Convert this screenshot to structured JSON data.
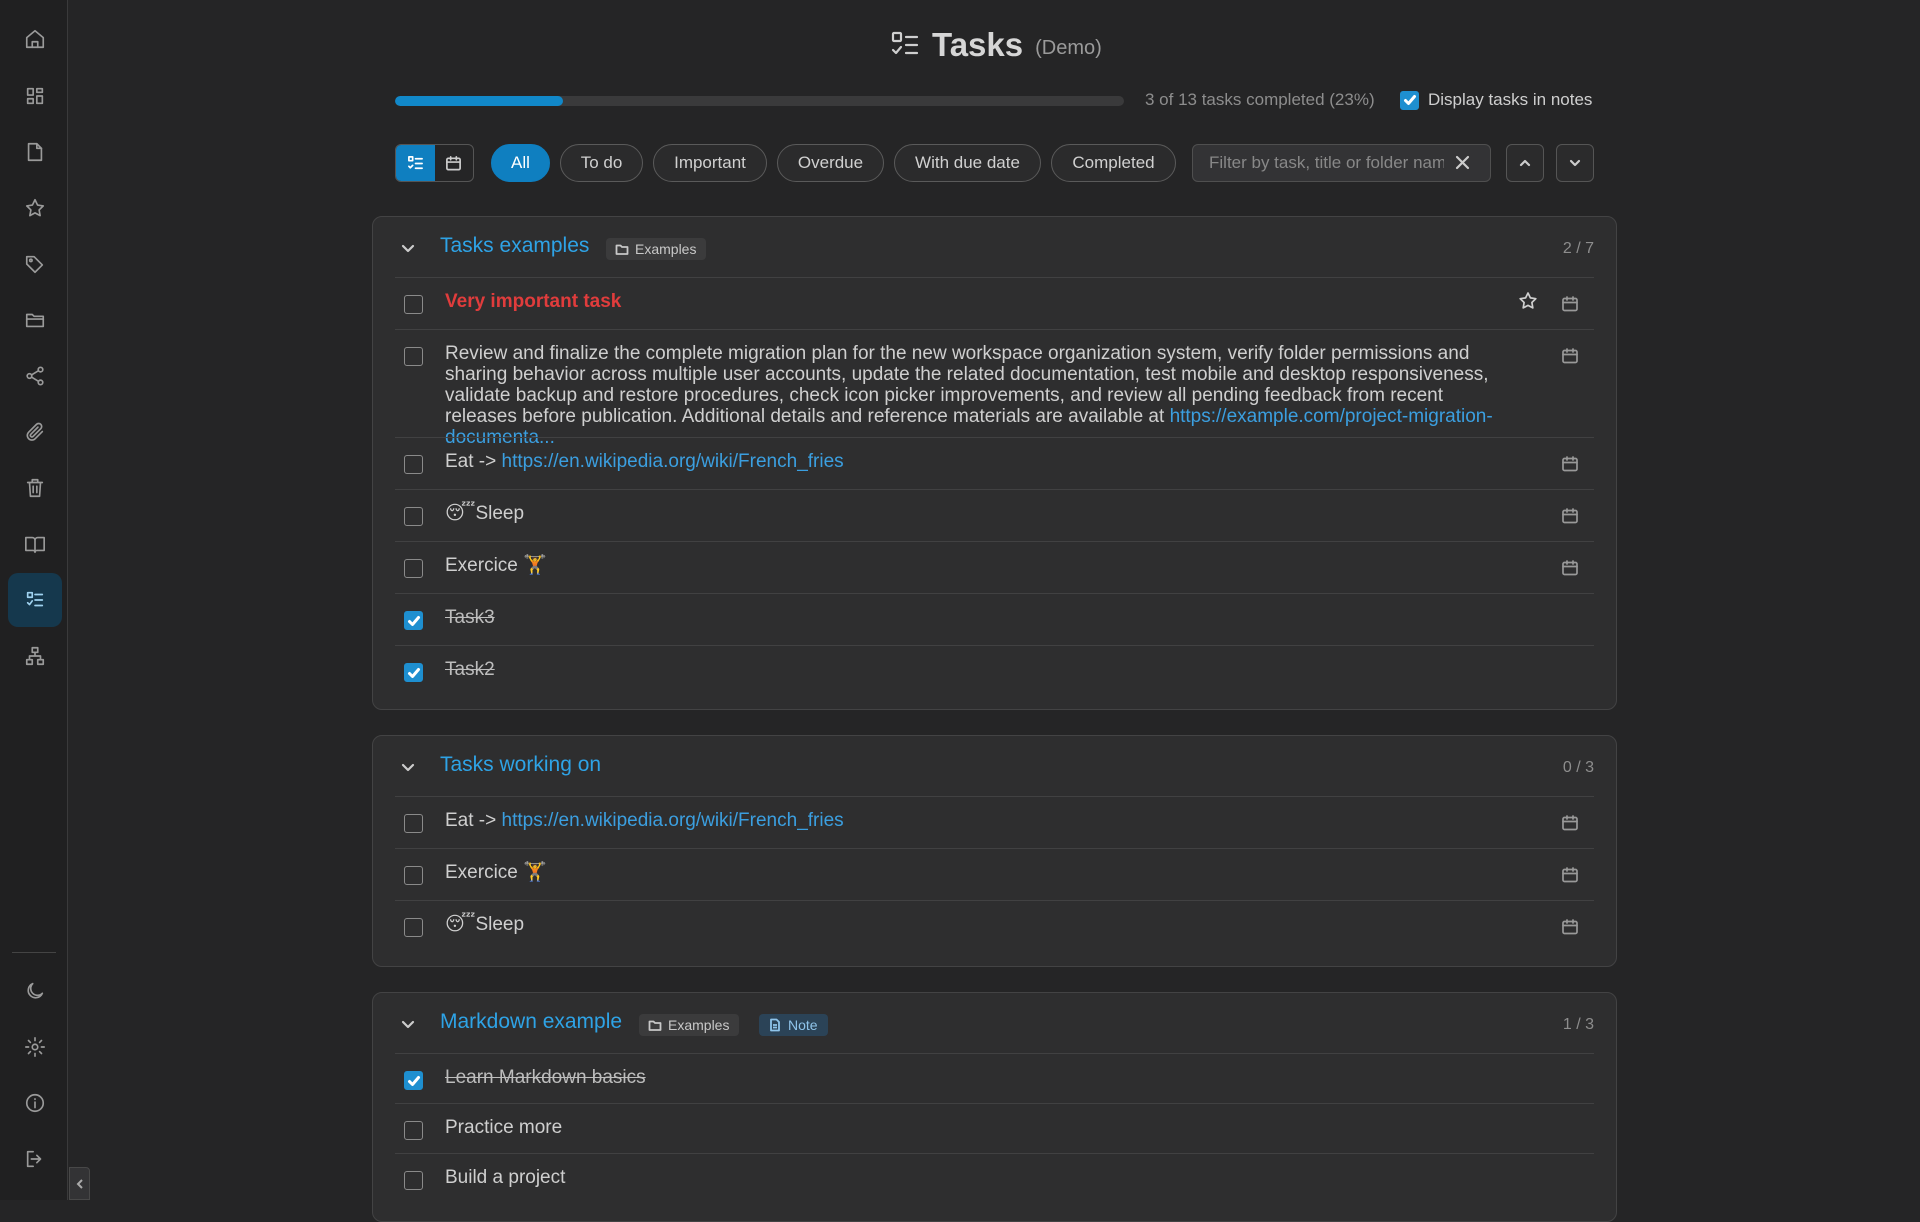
{
  "header": {
    "title": "Tasks",
    "subtitle": "(Demo)"
  },
  "progress": {
    "completed": 3,
    "total": 13,
    "fraction": 0.23,
    "text": "3 of 13 tasks completed (23%)"
  },
  "display_tasks": {
    "label": "Display tasks in notes",
    "checked": true
  },
  "filters": [
    {
      "label": "All",
      "active": true
    },
    {
      "label": "To do",
      "active": false
    },
    {
      "label": "Important",
      "active": false
    },
    {
      "label": "Overdue",
      "active": false
    },
    {
      "label": "With due date",
      "active": false
    },
    {
      "label": "Completed",
      "active": false
    }
  ],
  "search": {
    "placeholder": "Filter by task, title or folder name",
    "value": ""
  },
  "colors": {
    "accent": "#0f7fc0",
    "link": "#3b9fe0",
    "important": "#e03c3c"
  },
  "sidebar_icons": [
    "home-icon",
    "grid-icon",
    "note-icon",
    "star-icon",
    "tag-icon",
    "folder-icon",
    "share-icon",
    "paperclip-icon",
    "trash-icon",
    "book-icon",
    "tasks-icon",
    "sitemap-icon",
    "theme-icon",
    "gear-icon",
    "info-icon",
    "logout-icon"
  ],
  "groups": [
    {
      "title": "Tasks examples",
      "folder": "Examples",
      "count": "2 / 7",
      "tasks": [
        {
          "text": "Very important task",
          "checked": false,
          "important": true
        },
        {
          "text": "Review and finalize the complete migration plan for the new workspace organization system, verify folder permissions and sharing behavior across multiple user accounts, update the related documentation, test mobile and desktop responsiveness, validate backup and restore procedures, check icon picker improvements, and review all pending feedback from recent releases before publication. Additional details and reference materials are available at ",
          "link": "https://example.com/project-migration-documenta...",
          "checked": false
        },
        {
          "text": "Eat -> ",
          "link": "https://en.wikipedia.org/wiki/French_fries",
          "checked": false
        },
        {
          "text": "😴Sleep",
          "checked": false
        },
        {
          "text": "Exercice 🏋",
          "checked": false
        },
        {
          "text": "Task3",
          "checked": true
        },
        {
          "text": "Task2",
          "checked": true
        }
      ]
    },
    {
      "title": "Tasks working on",
      "count": "0 / 3",
      "tasks": [
        {
          "text": "Eat -> ",
          "link": "https://en.wikipedia.org/wiki/French_fries",
          "checked": false
        },
        {
          "text": "Exercice 🏋",
          "checked": false
        },
        {
          "text": "😴Sleep",
          "checked": false
        }
      ]
    },
    {
      "title": "Markdown example",
      "folder": "Examples",
      "note": "Note",
      "count": "1 / 3",
      "tasks": [
        {
          "text": "Learn Markdown basics",
          "checked": true
        },
        {
          "text": "Practice more",
          "checked": false
        },
        {
          "text": "Build a project",
          "checked": false
        }
      ]
    }
  ]
}
